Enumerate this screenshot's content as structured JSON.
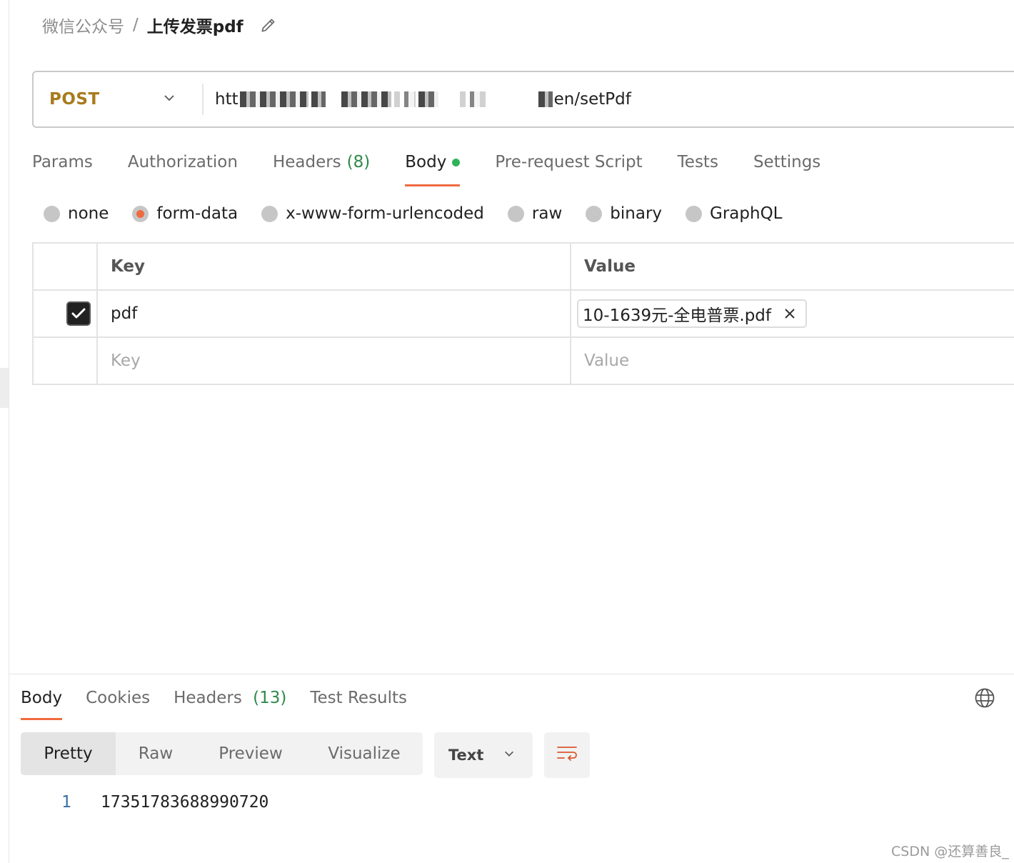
{
  "breadcrumb": {
    "parent": "微信公众号",
    "separator": "/",
    "current": "上传发票pdf"
  },
  "request": {
    "method": "POST",
    "url_prefix": "htt",
    "url_suffix": "en/setPdf"
  },
  "request_tabs": [
    {
      "label": "Params"
    },
    {
      "label": "Authorization"
    },
    {
      "label": "Headers",
      "count": "(8)"
    },
    {
      "label": "Body",
      "active": true
    },
    {
      "label": "Pre-request Script"
    },
    {
      "label": "Tests"
    },
    {
      "label": "Settings"
    }
  ],
  "body_types": [
    {
      "label": "none"
    },
    {
      "label": "form-data",
      "selected": true
    },
    {
      "label": "x-www-form-urlencoded"
    },
    {
      "label": "raw"
    },
    {
      "label": "binary"
    },
    {
      "label": "GraphQL"
    }
  ],
  "form_table": {
    "headers": {
      "key": "Key",
      "value": "Value"
    },
    "rows": [
      {
        "checked": true,
        "key": "pdf",
        "value": "10-1639元-全电普票.pdf"
      }
    ],
    "new_row": {
      "key_placeholder": "Key",
      "value_placeholder": "Value"
    }
  },
  "response_tabs": [
    {
      "label": "Body",
      "active": true
    },
    {
      "label": "Cookies"
    },
    {
      "label": "Headers",
      "count": "(13)"
    },
    {
      "label": "Test Results"
    }
  ],
  "view_modes": [
    "Pretty",
    "Raw",
    "Preview",
    "Visualize"
  ],
  "active_view": "Pretty",
  "format": "Text",
  "response_body": [
    {
      "line": "1",
      "text": "17351783688990720"
    }
  ],
  "watermark": "CSDN @还算善良_",
  "colors": {
    "accent": "#ef6a3f",
    "method": "#a87b1c",
    "green": "#2fb35a"
  }
}
